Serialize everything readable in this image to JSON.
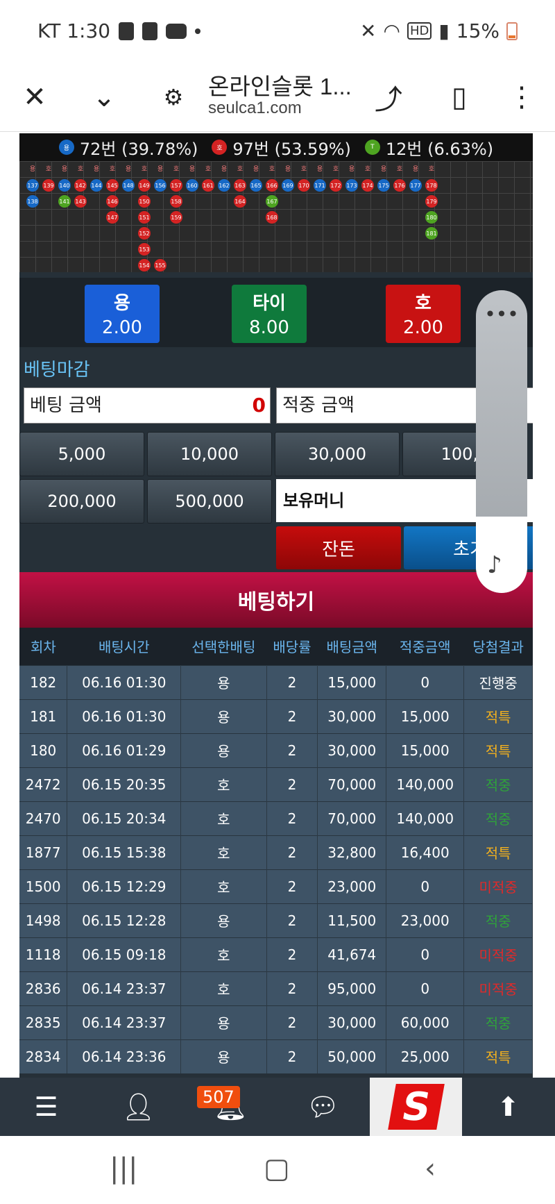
{
  "status": {
    "carrier_time": "KT 1:30",
    "battery": "15%",
    "hd": "HD"
  },
  "browser": {
    "title": "온라인슬롯 1...",
    "url": "seulca1.com"
  },
  "stats": {
    "dragon": {
      "label": "용",
      "text": "72번 (39.78%)"
    },
    "tiger": {
      "label": "호",
      "text": "97번 (53.59%)"
    },
    "tie": {
      "label": "T",
      "text": "12번 (6.63%)"
    }
  },
  "roadmap": {
    "cols": [
      {
        "head": "용",
        "dots": [
          {
            "n": "137",
            "c": "blue"
          },
          {
            "n": "138",
            "c": "blue"
          }
        ]
      },
      {
        "head": "호",
        "dots": [
          {
            "n": "139",
            "c": "red"
          }
        ]
      },
      {
        "head": "용",
        "dots": [
          {
            "n": "140",
            "c": "blue"
          },
          {
            "n": "141",
            "c": "green"
          }
        ]
      },
      {
        "head": "호",
        "dots": [
          {
            "n": "142",
            "c": "red"
          },
          {
            "n": "143",
            "c": "red"
          }
        ]
      },
      {
        "head": "용",
        "dots": [
          {
            "n": "144",
            "c": "blue"
          }
        ]
      },
      {
        "head": "호",
        "dots": [
          {
            "n": "145",
            "c": "red"
          },
          {
            "n": "146",
            "c": "red"
          },
          {
            "n": "147",
            "c": "red"
          }
        ]
      },
      {
        "head": "용",
        "dots": [
          {
            "n": "148",
            "c": "blue"
          }
        ]
      },
      {
        "head": "호",
        "dots": [
          {
            "n": "149",
            "c": "red"
          },
          {
            "n": "150",
            "c": "red"
          },
          {
            "n": "151",
            "c": "red"
          },
          {
            "n": "152",
            "c": "red"
          },
          {
            "n": "153",
            "c": "red"
          },
          {
            "n": "154",
            "c": "red"
          }
        ]
      },
      {
        "head": "용",
        "dots": [
          {
            "n": "156",
            "c": "blue"
          }
        ]
      },
      {
        "head": "호",
        "dots": [
          {
            "n": "157",
            "c": "red"
          },
          {
            "n": "158",
            "c": "red"
          },
          {
            "n": "159",
            "c": "red"
          }
        ]
      },
      {
        "head": "용",
        "dots": [
          {
            "n": "160",
            "c": "blue"
          }
        ]
      },
      {
        "head": "호",
        "dots": [
          {
            "n": "161",
            "c": "red"
          }
        ]
      },
      {
        "head": "용",
        "dots": [
          {
            "n": "162",
            "c": "blue"
          }
        ]
      },
      {
        "head": "호",
        "dots": [
          {
            "n": "163",
            "c": "red"
          },
          {
            "n": "164",
            "c": "red"
          }
        ]
      },
      {
        "head": "용",
        "dots": [
          {
            "n": "165",
            "c": "blue"
          }
        ]
      },
      {
        "head": "호",
        "dots": [
          {
            "n": "166",
            "c": "red"
          },
          {
            "n": "167",
            "c": "green"
          },
          {
            "n": "168",
            "c": "red"
          }
        ]
      },
      {
        "head": "용",
        "dots": [
          {
            "n": "169",
            "c": "blue"
          }
        ]
      },
      {
        "head": "호",
        "dots": [
          {
            "n": "170",
            "c": "red"
          }
        ]
      },
      {
        "head": "용",
        "dots": [
          {
            "n": "171",
            "c": "blue"
          }
        ]
      },
      {
        "head": "호",
        "dots": [
          {
            "n": "172",
            "c": "red"
          }
        ]
      },
      {
        "head": "용",
        "dots": [
          {
            "n": "173",
            "c": "blue"
          }
        ]
      },
      {
        "head": "호",
        "dots": [
          {
            "n": "174",
            "c": "red"
          }
        ]
      },
      {
        "head": "용",
        "dots": [
          {
            "n": "175",
            "c": "blue"
          }
        ]
      },
      {
        "head": "호",
        "dots": [
          {
            "n": "176",
            "c": "red"
          }
        ]
      },
      {
        "head": "용",
        "dots": [
          {
            "n": "177",
            "c": "blue"
          }
        ]
      },
      {
        "head": "호",
        "dots": [
          {
            "n": "178",
            "c": "red"
          },
          {
            "n": "179",
            "c": "red"
          },
          {
            "n": "180",
            "c": "green"
          },
          {
            "n": "181",
            "c": "green"
          }
        ]
      }
    ],
    "extra_dot": {
      "n": "155",
      "c": "red"
    }
  },
  "bets": {
    "dragon": {
      "name": "용",
      "odds": "2.00"
    },
    "tie": {
      "name": "타이",
      "odds": "8.00"
    },
    "tiger": {
      "name": "호",
      "odds": "2.00"
    }
  },
  "form": {
    "deadline": "베팅마감",
    "bet_amount_label": "베팅 금액",
    "bet_amount_value": "0",
    "hit_amount_label": "적중 금액",
    "amounts": [
      "5,000",
      "10,000",
      "30,000",
      "100,0",
      "200,000",
      "500,000"
    ],
    "holding_money": "보유머니",
    "change_btn": "잔돈",
    "reset_btn": "초기"
  },
  "submit_label": "베팅하기",
  "table": {
    "headers": [
      "회차",
      "배팅시간",
      "선택한배팅",
      "배당률",
      "배팅금액",
      "적중금액",
      "당첨결과"
    ],
    "rows": [
      [
        "182",
        "06.16 01:30",
        "용",
        "2",
        "15,000",
        "0",
        "진행중",
        "prog"
      ],
      [
        "181",
        "06.16 01:30",
        "용",
        "2",
        "30,000",
        "15,000",
        "적특",
        "hit"
      ],
      [
        "180",
        "06.16 01:29",
        "용",
        "2",
        "30,000",
        "15,000",
        "적특",
        "hit"
      ],
      [
        "2472",
        "06.15 20:35",
        "호",
        "2",
        "70,000",
        "140,000",
        "적중",
        "won"
      ],
      [
        "2470",
        "06.15 20:34",
        "호",
        "2",
        "70,000",
        "140,000",
        "적중",
        "won"
      ],
      [
        "1877",
        "06.15 15:38",
        "호",
        "2",
        "32,800",
        "16,400",
        "적특",
        "hit"
      ],
      [
        "1500",
        "06.15 12:29",
        "호",
        "2",
        "23,000",
        "0",
        "미적중",
        "lost"
      ],
      [
        "1498",
        "06.15 12:28",
        "용",
        "2",
        "11,500",
        "23,000",
        "적중",
        "won"
      ],
      [
        "1118",
        "06.15 09:18",
        "호",
        "2",
        "41,674",
        "0",
        "미적중",
        "lost"
      ],
      [
        "2836",
        "06.14 23:37",
        "호",
        "2",
        "95,000",
        "0",
        "미적중",
        "lost"
      ],
      [
        "2835",
        "06.14 23:37",
        "용",
        "2",
        "30,000",
        "60,000",
        "적중",
        "won"
      ],
      [
        "2834",
        "06.14 23:36",
        "용",
        "2",
        "50,000",
        "25,000",
        "적특",
        "hit"
      ]
    ]
  },
  "sitenav": {
    "badge": "507",
    "logo": "S"
  }
}
